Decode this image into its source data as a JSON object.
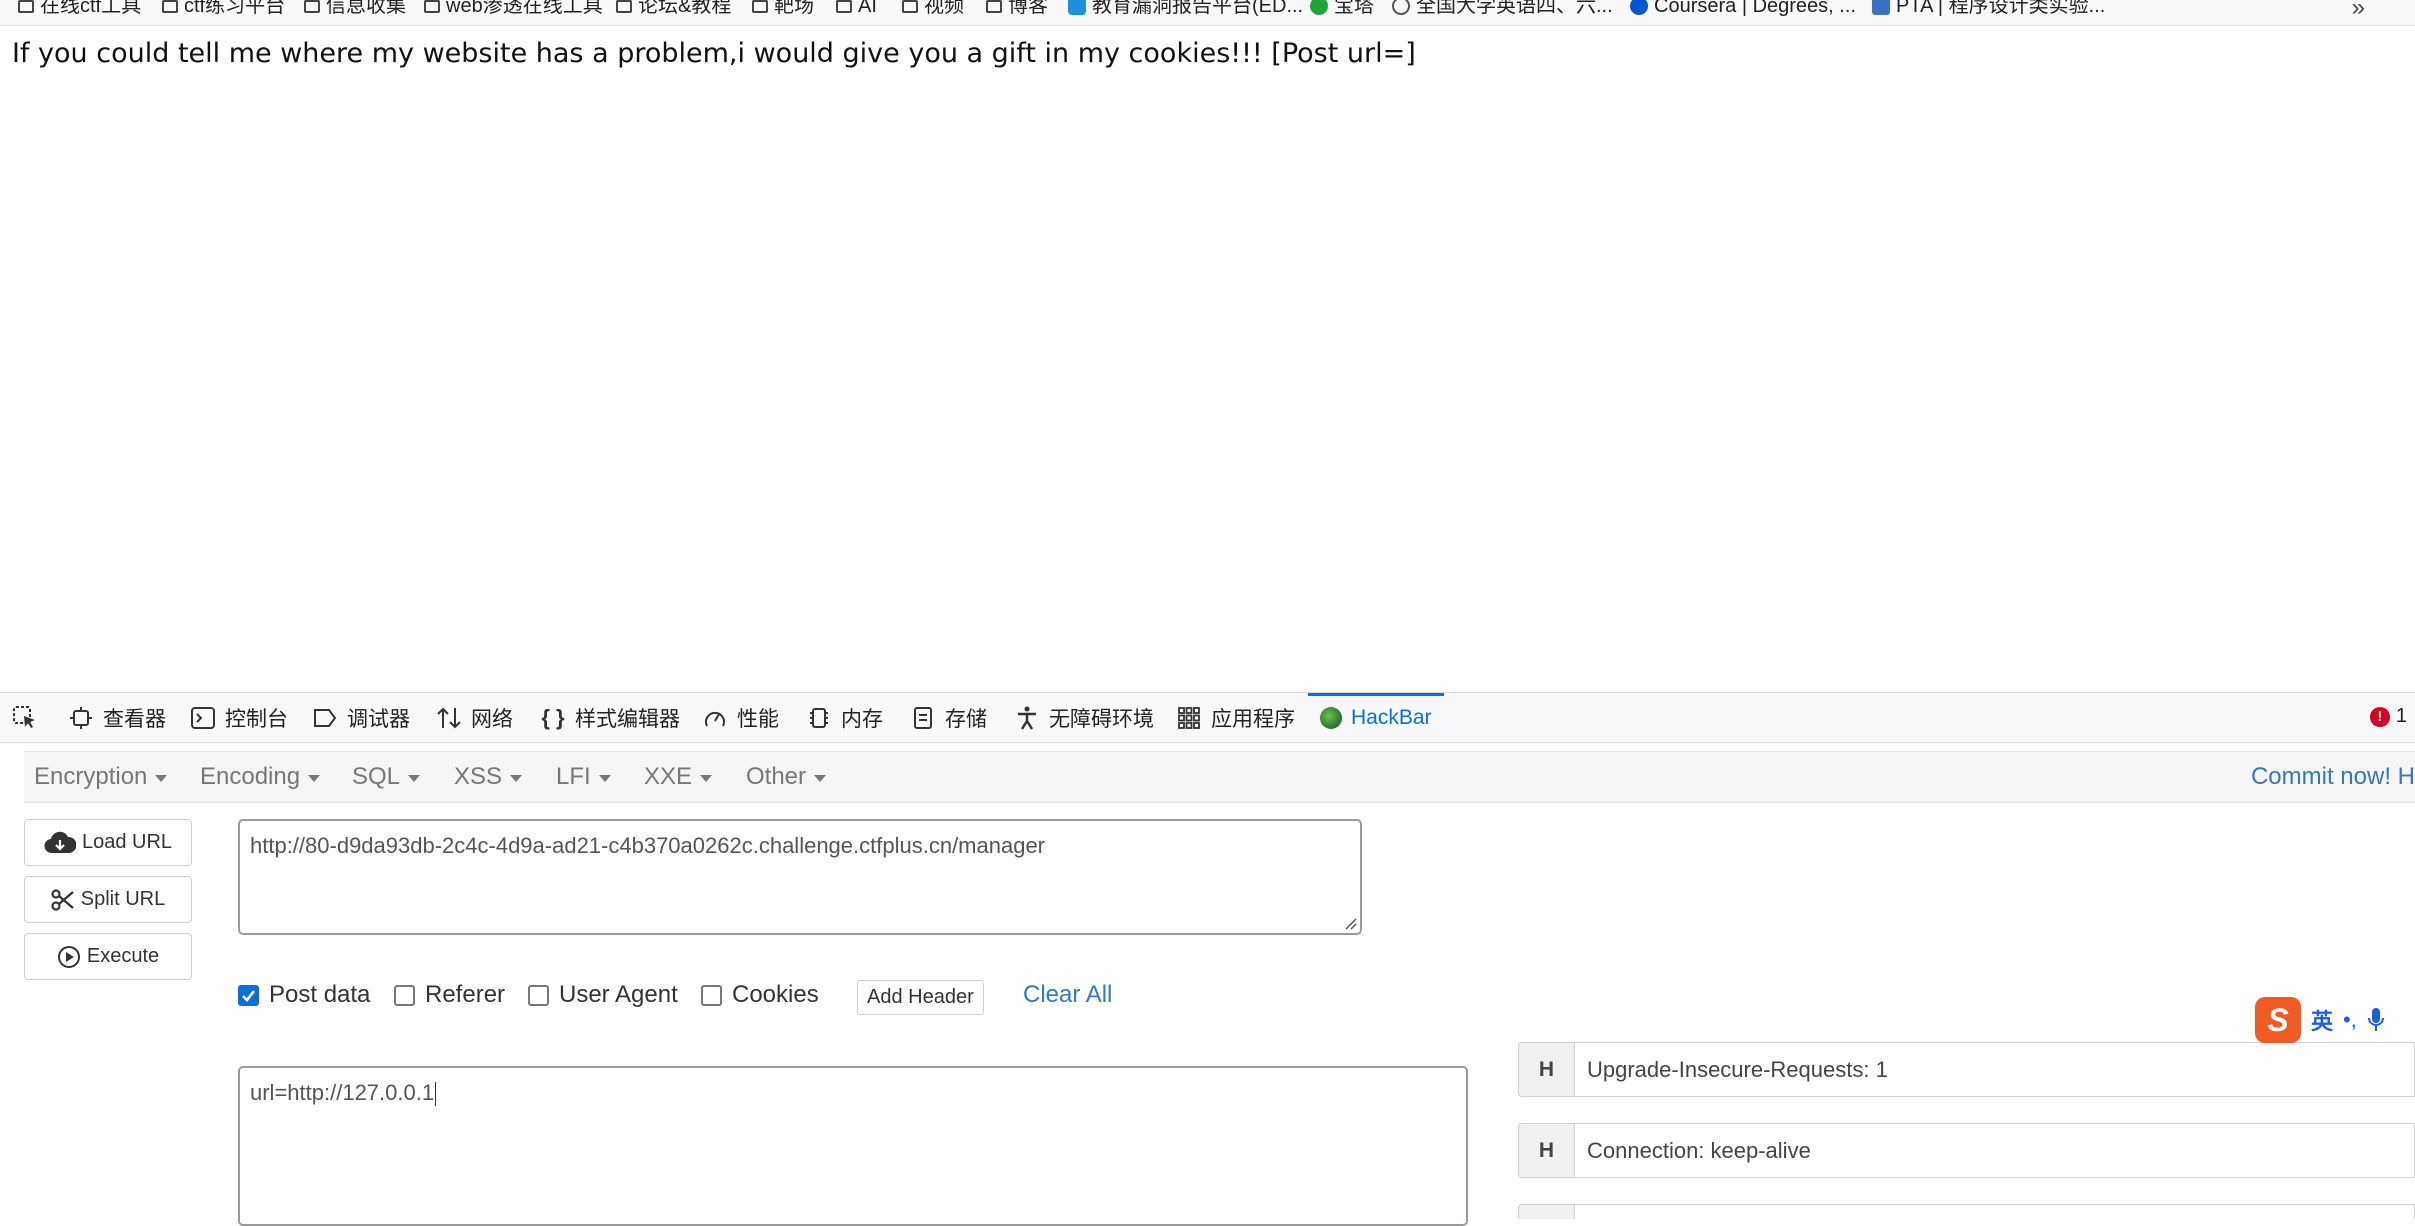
{
  "bookmarks": [
    {
      "label": "在线ctf工具",
      "icon": "folder-icon"
    },
    {
      "label": "ctf练习平台",
      "icon": "folder-icon"
    },
    {
      "label": "信息收集",
      "icon": "folder-icon"
    },
    {
      "label": "web渗透在线工具",
      "icon": "folder-icon"
    },
    {
      "label": "论坛&教程",
      "icon": "folder-icon"
    },
    {
      "label": "靶场",
      "icon": "folder-icon"
    },
    {
      "label": "AI",
      "icon": "folder-icon"
    },
    {
      "label": "视频",
      "icon": "folder-icon"
    },
    {
      "label": "博客",
      "icon": "folder-icon"
    },
    {
      "label": "教育漏洞报告平台(ED...",
      "icon": "edu-bird-icon"
    },
    {
      "label": "宝塔",
      "icon": "bt-icon"
    },
    {
      "label": "全国大学英语四、六...",
      "icon": "globe-icon"
    },
    {
      "label": "Coursera | Degrees, ...",
      "icon": "coursera-icon"
    },
    {
      "label": "PTA | 程序设计类实验...",
      "icon": "pta-icon"
    }
  ],
  "page": {
    "message": "If you could tell me where my website has a problem,i would give you a gift in my cookies!!! [Post url=]"
  },
  "devtools": {
    "tabs": [
      {
        "label": "查看器",
        "icon": "inspector-icon"
      },
      {
        "label": "控制台",
        "icon": "console-icon"
      },
      {
        "label": "调试器",
        "icon": "debugger-icon"
      },
      {
        "label": "网络",
        "icon": "network-icon"
      },
      {
        "label": "样式编辑器",
        "icon": "style-editor-icon"
      },
      {
        "label": "性能",
        "icon": "performance-icon"
      },
      {
        "label": "内存",
        "icon": "memory-icon"
      },
      {
        "label": "存储",
        "icon": "storage-icon"
      },
      {
        "label": "无障碍环境",
        "icon": "accessibility-icon"
      },
      {
        "label": "应用程序",
        "icon": "application-icon"
      },
      {
        "label": "HackBar",
        "icon": "hackbar-icon",
        "active": true
      }
    ],
    "error_count": "1",
    "accent_color": "#0a6ee0"
  },
  "hackbar": {
    "menu": [
      "Encryption",
      "Encoding",
      "SQL",
      "XSS",
      "LFI",
      "XXE",
      "Other"
    ],
    "commit_link": "Commit now! H",
    "buttons": {
      "load_url": "Load URL",
      "split_url": "Split URL",
      "execute": "Execute"
    },
    "url": "http://80-d9da93db-2c4c-4d9a-ad21-c4b370a0262c.challenge.ctfplus.cn/manager",
    "options": {
      "post_data": {
        "label": "Post data",
        "checked": true
      },
      "referer": {
        "label": "Referer",
        "checked": false
      },
      "user_agent": {
        "label": "User Agent",
        "checked": false
      },
      "cookies": {
        "label": "Cookies",
        "checked": false
      }
    },
    "add_header_label": "Add Header",
    "clear_all_label": "Clear All",
    "post_body": "url=http://127.0.0.1",
    "headers": [
      {
        "key": "H",
        "value": "Upgrade-Insecure-Requests: 1"
      },
      {
        "key": "H",
        "value": "Connection: keep-alive"
      }
    ]
  },
  "ime": {
    "logo": "S",
    "mode": "英"
  }
}
